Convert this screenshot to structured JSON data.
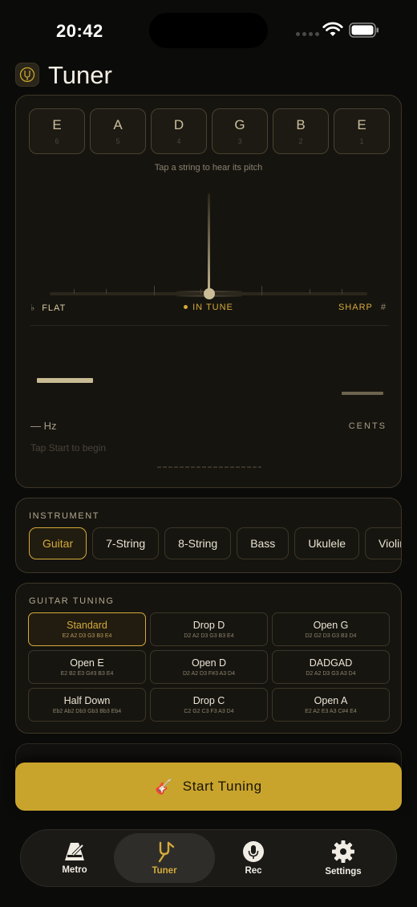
{
  "status_bar": {
    "time": "20:42"
  },
  "header": {
    "title": "Tuner"
  },
  "tuner": {
    "strings": [
      {
        "note": "E",
        "number": "6"
      },
      {
        "note": "A",
        "number": "5"
      },
      {
        "note": "D",
        "number": "4"
      },
      {
        "note": "G",
        "number": "3"
      },
      {
        "note": "B",
        "number": "2"
      },
      {
        "note": "E",
        "number": "1"
      }
    ],
    "hint": "Tap a string to hear its pitch",
    "flat_symbol": "♭",
    "flat_label": "FLAT",
    "in_tune_label": "IN TUNE",
    "sharp_label": "SHARP",
    "sharp_symbol": "#",
    "frequency": "— Hz",
    "cents_label": "CENTS",
    "status": "Tap Start to begin"
  },
  "instrument": {
    "label": "INSTRUMENT",
    "options": [
      "Guitar",
      "7-String",
      "8-String",
      "Bass",
      "Ukulele",
      "Violin"
    ],
    "selected": "Guitar"
  },
  "tuning": {
    "label": "GUITAR TUNING",
    "options": [
      {
        "name": "Standard",
        "notes": "E2 A2 D3 G3 B3 E4"
      },
      {
        "name": "Drop D",
        "notes": "D2 A2 D3 G3 B3 E4"
      },
      {
        "name": "Open G",
        "notes": "D2 G2 D3 G3 B3 D4"
      },
      {
        "name": "Open E",
        "notes": "E2 B2 E3 G#3 B3 E4"
      },
      {
        "name": "Open D",
        "notes": "D2 A2 D3 F#3 A3 D4"
      },
      {
        "name": "DADGAD",
        "notes": "D2 A2 D3 G3 A3 D4"
      },
      {
        "name": "Half Down",
        "notes": "Eb2 Ab2 Db3 Gb3 Bb3 Eb4"
      },
      {
        "name": "Drop C",
        "notes": "C2 G2 C3 F3 A3 D4"
      },
      {
        "name": "Open A",
        "notes": "E2 A2 E3 A3 C#4 E4"
      }
    ],
    "selected": "Standard"
  },
  "start_button": {
    "icon": "🎸",
    "label": "Start Tuning"
  },
  "tabbar": {
    "tabs": [
      {
        "label": "Metro",
        "icon": "metronome-icon"
      },
      {
        "label": "Tuner",
        "icon": "tuning-fork-icon"
      },
      {
        "label": "Rec",
        "icon": "microphone-icon"
      },
      {
        "label": "Settings",
        "icon": "gear-icon"
      }
    ],
    "active": "Tuner"
  },
  "colors": {
    "accent": "#d4aa3a",
    "button": "#c9a42c",
    "background": "#0b0b09",
    "card": "#16140f"
  }
}
